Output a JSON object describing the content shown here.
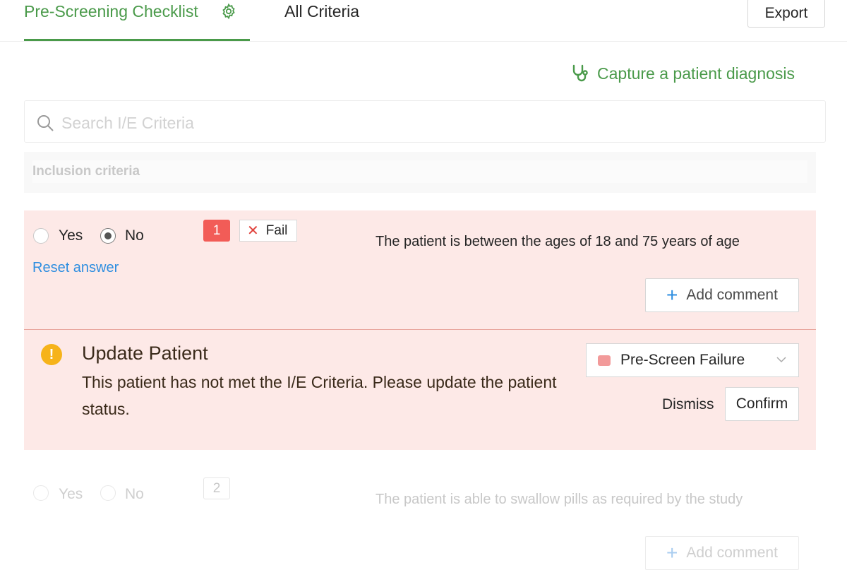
{
  "tabs": {
    "active_label": "Pre-Screening Checklist",
    "all_label": "All Criteria"
  },
  "toolbar": {
    "export_label": "Export"
  },
  "capture_link": {
    "label": "Capture a patient diagnosis",
    "icon": "stethoscope-icon"
  },
  "search": {
    "placeholder": "Search I/E Criteria",
    "value": ""
  },
  "section": {
    "label": "Inclusion criteria"
  },
  "criteria": [
    {
      "number": "1",
      "yes_label": "Yes",
      "no_label": "No",
      "selected": "No",
      "result_label": "Fail",
      "reset_label": "Reset answer",
      "text": "The patient is between the ages of 18 and 75 years of age",
      "add_comment_label": "Add comment"
    },
    {
      "number": "2",
      "yes_label": "Yes",
      "no_label": "No",
      "selected": "",
      "text": "The patient is able to swallow pills as required by the study",
      "add_comment_label": "Add comment"
    }
  ],
  "alert": {
    "title": "Update Patient",
    "message": "This patient has not met the I/E Criteria. Please update the patient status.",
    "status_value": "Pre-Screen Failure",
    "dismiss_label": "Dismiss",
    "confirm_label": "Confirm"
  },
  "colors": {
    "accent_green": "#4a9a4a",
    "fail_red": "#f25c57",
    "alert_bg": "#fde9e7",
    "warning_yellow": "#f6b31a",
    "link_blue": "#2e8ee0",
    "status_swatch": "#f29a9a"
  }
}
